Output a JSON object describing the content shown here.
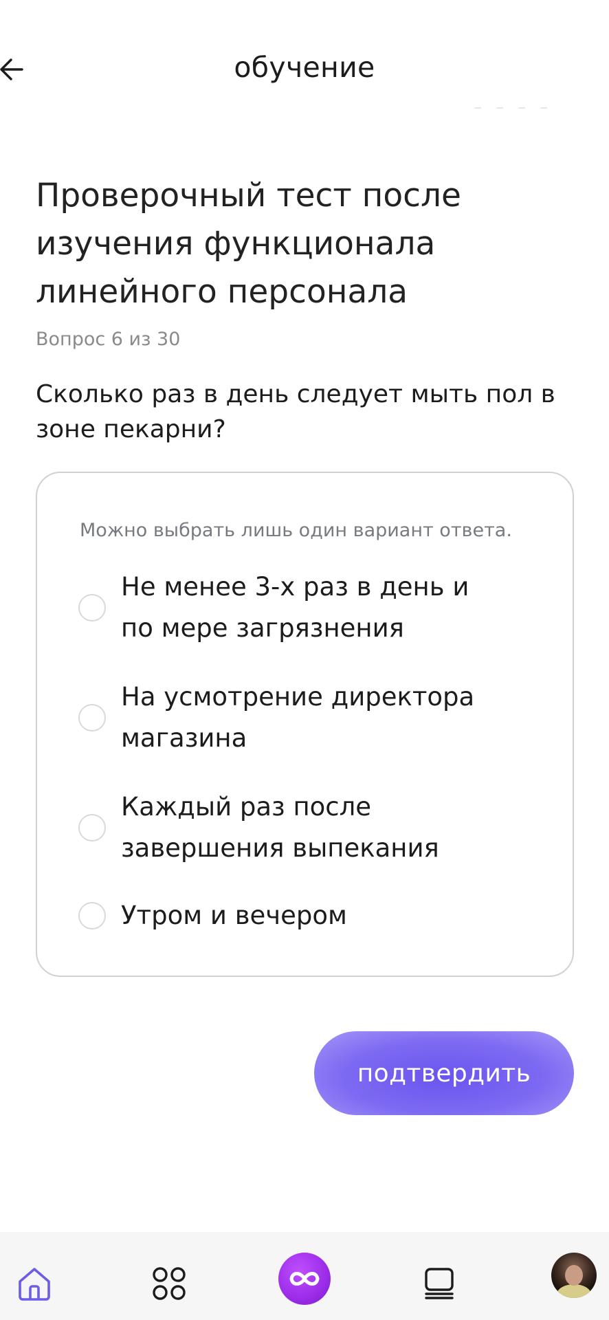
{
  "header": {
    "title": "обучение"
  },
  "test": {
    "title": "Проверочный тест после изучения функционала линейного персонала",
    "counter": "Вопрос 6 из 30",
    "question": "Сколько раз в день следует мыть пол в зоне пекарни?"
  },
  "answers": {
    "hint": "Можно выбрать лишь один вариант ответа.",
    "options": [
      {
        "label": "Не менее 3-х раз в день и по мере загрязнения",
        "selected": false
      },
      {
        "label": "На усмотрение директора магазина",
        "selected": false
      },
      {
        "label": "Каждый раз после завершения выпекания",
        "selected": false
      },
      {
        "label": "Утром и вечером",
        "selected": false
      }
    ]
  },
  "actions": {
    "confirm_label": "подтвердить"
  },
  "bottom_nav": {
    "items": [
      {
        "icon": "home-icon",
        "active": true
      },
      {
        "icon": "grid-icon",
        "active": false
      },
      {
        "icon": "infinity-icon",
        "active": false
      },
      {
        "icon": "courses-icon",
        "active": false
      },
      {
        "icon": "avatar",
        "active": false
      }
    ]
  },
  "colors": {
    "accent": "#6c5ce7",
    "brand_center": "#9b2ce8",
    "card_border": "#cfd1d4",
    "muted_text": "#8a8a8a"
  }
}
